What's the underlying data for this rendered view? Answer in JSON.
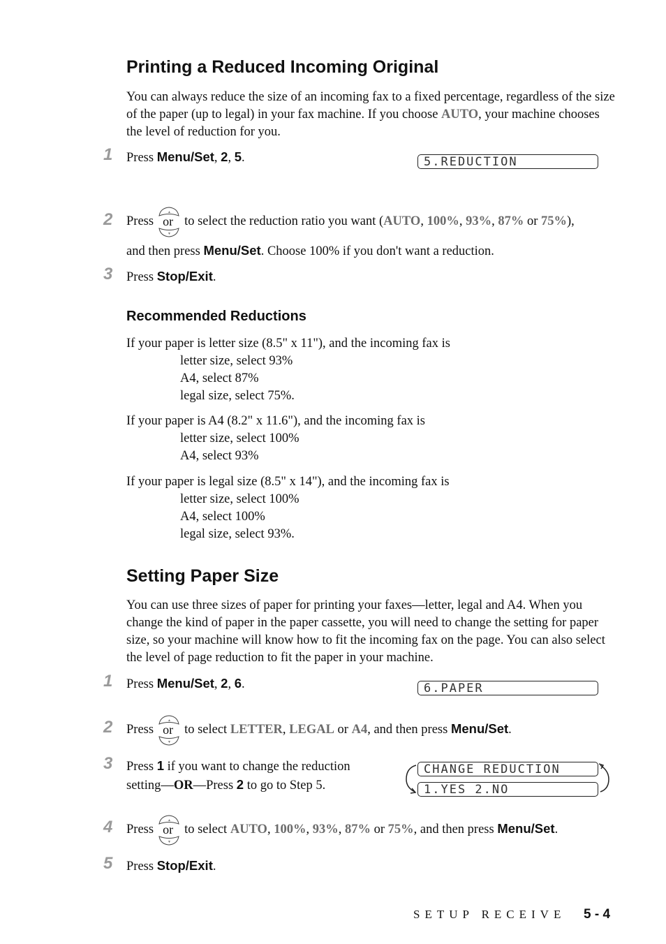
{
  "section1": {
    "title": "Printing a Reduced Incoming Original",
    "intro_a": "You can always reduce the size of an incoming fax to a fixed percentage, regardless of the size of the paper (up to legal) in your fax machine.  If you choose ",
    "intro_auto": "AUTO",
    "intro_b": ", your machine chooses the level of reduction for you.",
    "steps": [
      {
        "num": "1",
        "pre": "Press ",
        "key": "Menu/Set",
        "sep1": ", ",
        "k2": "2",
        "sep2": ", ",
        "k3": "5",
        "end": ".",
        "lcd": "5.REDUCTION"
      },
      {
        "num": "2",
        "pre": "Press",
        "or": "or",
        "mid": "to select the reduction ratio you want (",
        "opts": [
          "AUTO",
          "100%",
          "93%",
          "87%",
          "75%"
        ],
        "or_word": "or",
        "close": "),",
        "line2_pre": "and then press ",
        "line2_key": "Menu/Set",
        "line2_post": ".  Choose 100% if you don't want a reduction."
      },
      {
        "num": "3",
        "pre": "Press ",
        "key": "Stop/Exit",
        "end": "."
      }
    ]
  },
  "recommended": {
    "title": "Recommended Reductions",
    "groups": [
      {
        "lead": "If your paper is letter size (8.5\" x 11\"), and the incoming fax is",
        "items": [
          "letter size, select 93%",
          "A4, select 87%",
          "legal size, select 75%."
        ]
      },
      {
        "lead": "If your paper is A4 (8.2\" x 11.6\"), and the incoming fax is",
        "items": [
          "letter size, select 100%",
          "A4, select 93%"
        ]
      },
      {
        "lead": "If your paper is legal size (8.5\" x 14\"), and the incoming fax is",
        "items": [
          "letter size, select 100%",
          "A4, select 100%",
          "legal size, select 93%."
        ]
      }
    ]
  },
  "section2": {
    "title": "Setting Paper Size",
    "intro": "You can use three sizes of paper for printing your faxes—letter, legal and A4.  When you change the kind of paper in the paper cassette, you will need to change the setting for paper size, so your machine will know how to fit the incoming fax on the page. You can also select the level of page reduction to fit the paper in your machine.",
    "steps": [
      {
        "num": "1",
        "pre": "Press ",
        "key": "Menu/Set",
        "sep1": ", ",
        "k2": "2",
        "sep2": ", ",
        "k3": "6",
        "end": ".",
        "lcd": "6.PAPER"
      },
      {
        "num": "2",
        "pre": "Press",
        "or": "or",
        "mid": "to select ",
        "opts": [
          "LETTER",
          "LEGAL",
          "A4"
        ],
        "or_word": "or",
        "post": ", and then press ",
        "key": "Menu/Set",
        "end": "."
      },
      {
        "num": "3",
        "pre": "Press ",
        "k1": "1",
        "mid": " if you want to change the reduction",
        "line2_a": "setting—",
        "line2_or": "OR",
        "line2_b": "—Press ",
        "line2_k": "2",
        "line2_c": " to go to Step 5.",
        "lcd1": "CHANGE REDUCTION",
        "lcd2": "1.YES 2.NO"
      },
      {
        "num": "4",
        "pre": "Press",
        "or": "or",
        "mid": "to select ",
        "opts": [
          "AUTO",
          "100%",
          "93%",
          "87%",
          "75%"
        ],
        "or_word": "or",
        "post": ", and then press ",
        "key": "Menu/Set",
        "end": "."
      },
      {
        "num": "5",
        "pre": "Press ",
        "key": "Stop/Exit",
        "end": "."
      }
    ]
  },
  "footer": {
    "section": "SETUP RECEIVE",
    "page": "5 - 4"
  }
}
